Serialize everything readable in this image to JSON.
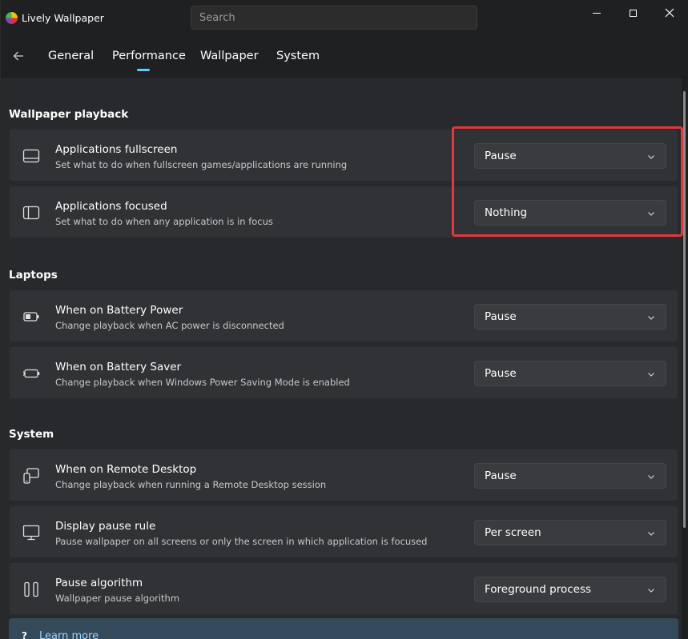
{
  "app": {
    "title": "Lively Wallpaper",
    "search_placeholder": "Search"
  },
  "nav": {
    "tabs": [
      {
        "label": "General"
      },
      {
        "label": "Performance",
        "selected": true
      },
      {
        "label": "Wallpaper"
      },
      {
        "label": "System"
      }
    ]
  },
  "sections": {
    "playback": {
      "title": "Wallpaper playback",
      "items": [
        {
          "title": "Applications fullscreen",
          "desc": "Set what to do when fullscreen games/applications are running",
          "value": "Pause",
          "icon": "fullscreen-window-icon"
        },
        {
          "title": "Applications focused",
          "desc": "Set what to do when any application is in focus",
          "value": "Nothing",
          "icon": "focused-window-icon"
        }
      ]
    },
    "laptops": {
      "title": "Laptops",
      "items": [
        {
          "title": "When on Battery Power",
          "desc": "Change playback when AC power is disconnected",
          "value": "Pause",
          "icon": "battery-icon"
        },
        {
          "title": "When on Battery Saver",
          "desc": "Change playback when Windows Power Saving Mode is enabled",
          "value": "Pause",
          "icon": "battery-saver-icon"
        }
      ]
    },
    "system": {
      "title": "System",
      "items": [
        {
          "title": "When on Remote Desktop",
          "desc": "Change playback when running a Remote Desktop session",
          "value": "Pause",
          "icon": "remote-desktop-icon"
        },
        {
          "title": "Display pause rule",
          "desc": "Pause wallpaper on all screens or only the screen in which application is focused",
          "value": "Per screen",
          "icon": "monitor-icon"
        },
        {
          "title": "Pause algorithm",
          "desc": "Wallpaper pause algorithm",
          "value": "Foreground process",
          "icon": "pause-icon"
        }
      ]
    }
  },
  "help": {
    "icon_text": "?",
    "link": "Learn more"
  },
  "colors": {
    "accent": "#60cdff",
    "highlight": "#e0393e"
  }
}
